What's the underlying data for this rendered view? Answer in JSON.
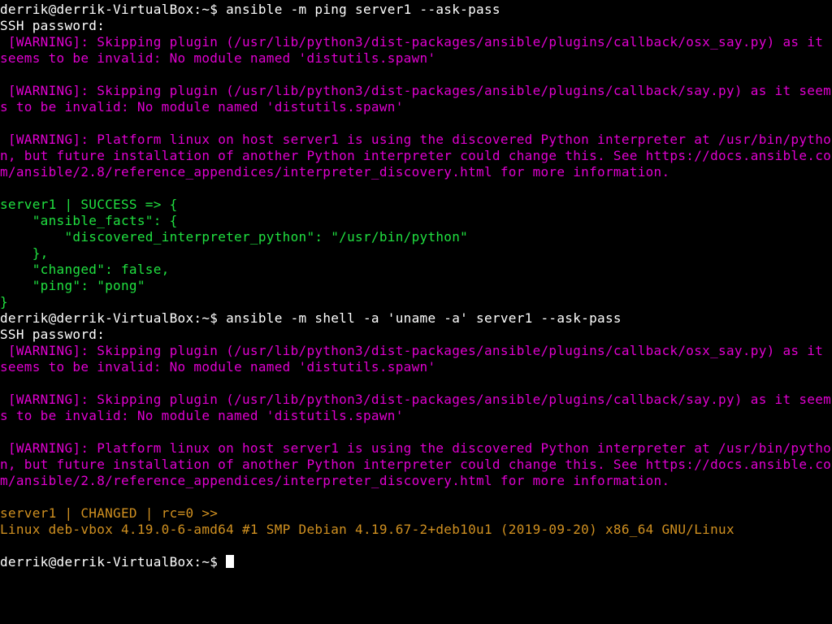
{
  "colors": {
    "magenta": "#e000d0",
    "green": "#20e040",
    "orange": "#d09020"
  },
  "block1": {
    "prompt": "derrik@derrik-VirtualBox:~$ ",
    "command": "ansible -m ping server1 --ask-pass",
    "ssh_prompt": "SSH password:",
    "warn_osx_say": " [WARNING]: Skipping plugin (/usr/lib/python3/dist-packages/ansible/plugins/callback/osx_say.py) as it seems to be invalid: No module named 'distutils.spawn'",
    "warn_say": " [WARNING]: Skipping plugin (/usr/lib/python3/dist-packages/ansible/plugins/callback/say.py) as it seems to be invalid: No module named 'distutils.spawn'",
    "warn_interp": " [WARNING]: Platform linux on host server1 is using the discovered Python interpreter at /usr/bin/python, but future installation of another Python interpreter could change this. See https://docs.ansible.com/ansible/2.8/reference_appendices/interpreter_discovery.html for more information.",
    "success": "server1 | SUCCESS => {\n    \"ansible_facts\": {\n        \"discovered_interpreter_python\": \"/usr/bin/python\"\n    },\n    \"changed\": false,\n    \"ping\": \"pong\"\n}"
  },
  "block2": {
    "prompt": "derrik@derrik-VirtualBox:~$ ",
    "command": "ansible -m shell -a 'uname -a' server1 --ask-pass",
    "ssh_prompt": "SSH password:",
    "warn_osx_say": " [WARNING]: Skipping plugin (/usr/lib/python3/dist-packages/ansible/plugins/callback/osx_say.py) as it seems to be invalid: No module named 'distutils.spawn'",
    "warn_say": " [WARNING]: Skipping plugin (/usr/lib/python3/dist-packages/ansible/plugins/callback/say.py) as it seems to be invalid: No module named 'distutils.spawn'",
    "warn_interp": " [WARNING]: Platform linux on host server1 is using the discovered Python interpreter at /usr/bin/python, but future installation of another Python interpreter could change this. See https://docs.ansible.com/ansible/2.8/reference_appendices/interpreter_discovery.html for more information.",
    "changed_header": "server1 | CHANGED | rc=0 >>",
    "uname_output": "Linux deb-vbox 4.19.0-6-amd64 #1 SMP Debian 4.19.67-2+deb10u1 (2019-09-20) x86_64 GNU/Linux"
  },
  "final": {
    "prompt": "derrik@derrik-VirtualBox:~$ "
  }
}
